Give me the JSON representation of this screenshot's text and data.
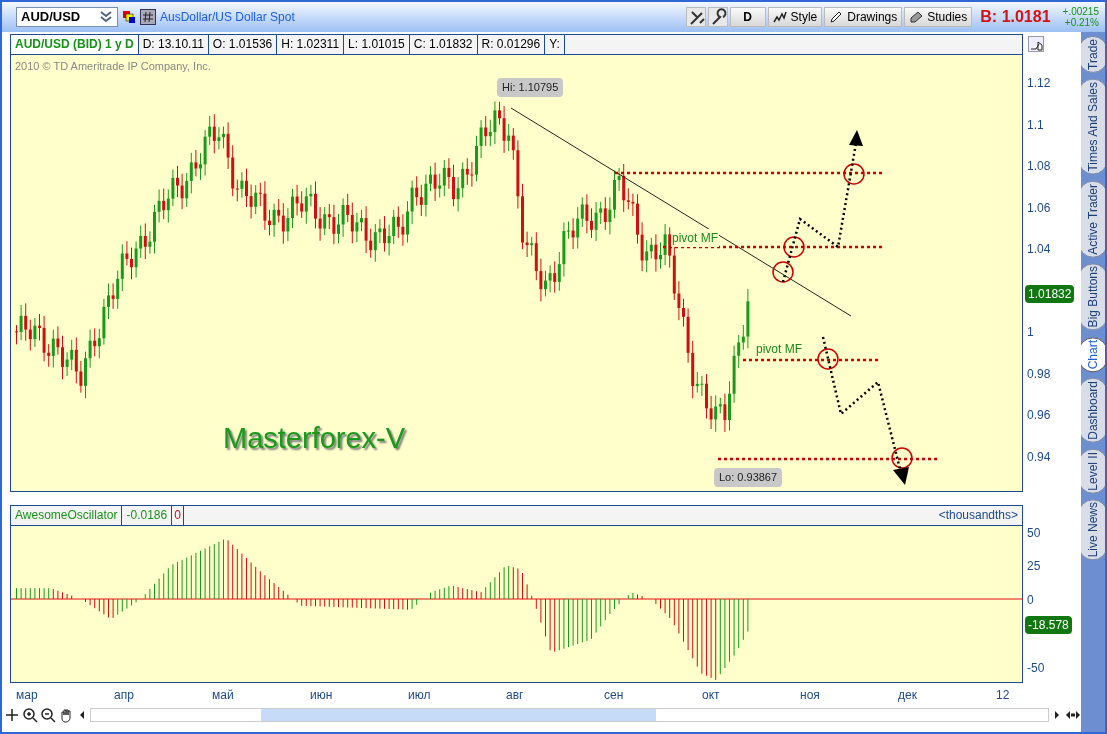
{
  "window": {
    "symbol": "AUD/USD",
    "description": "AusDollar/US Dollar Spot"
  },
  "toolbar": {
    "buttons": [
      "D",
      "Style",
      "Drawings",
      "Studies"
    ],
    "bid": "B: 1.0181",
    "change": "+.00215",
    "change_pct": "+0.21%"
  },
  "info_bar": {
    "title": "AUD/USD (BID) 1 y D",
    "fields": [
      "D: 13.10.11",
      "O: 1.01536",
      "H: 1.02311",
      "L: 1.01015",
      "C: 1.01832",
      "R: 0.01296",
      "Y:"
    ]
  },
  "price_chart": {
    "copyright": "2010 © TD Ameritrade IP Company, Inc.",
    "high_label": "Hi: 1.10795",
    "low_label": "Lo: 0.93867",
    "pivot_labels": [
      "pivot MF",
      "pivot MF"
    ],
    "title_text": "Masterforex-V",
    "y_ticks": [
      "1.12",
      "1.1",
      "1.08",
      "1.06",
      "1.04",
      "1",
      "0.98",
      "0.96",
      "0.94"
    ],
    "last_price": "1.01832"
  },
  "oscillator": {
    "name": "AwesomeOscillator",
    "value": "-0.0186",
    "signal": "0",
    "units": "<thousandths>",
    "y_ticks": [
      "50",
      "25",
      "0",
      "-50"
    ],
    "last_value": "-18.578"
  },
  "x_labels": [
    "мар",
    "апр",
    "май",
    "июн",
    "июл",
    "авг",
    "сен",
    "окт",
    "ноя",
    "дек",
    "12"
  ],
  "sidebar_tabs": [
    {
      "label": "Trade",
      "selected": false
    },
    {
      "label": "Times And Sales",
      "selected": false
    },
    {
      "label": "Active Trader",
      "selected": false
    },
    {
      "label": "Big Buttons",
      "selected": false
    },
    {
      "label": "Chart",
      "selected": true
    },
    {
      "label": "Dashboard",
      "selected": false
    },
    {
      "label": "Level II",
      "selected": false
    },
    {
      "label": "Live News",
      "selected": false
    }
  ]
}
